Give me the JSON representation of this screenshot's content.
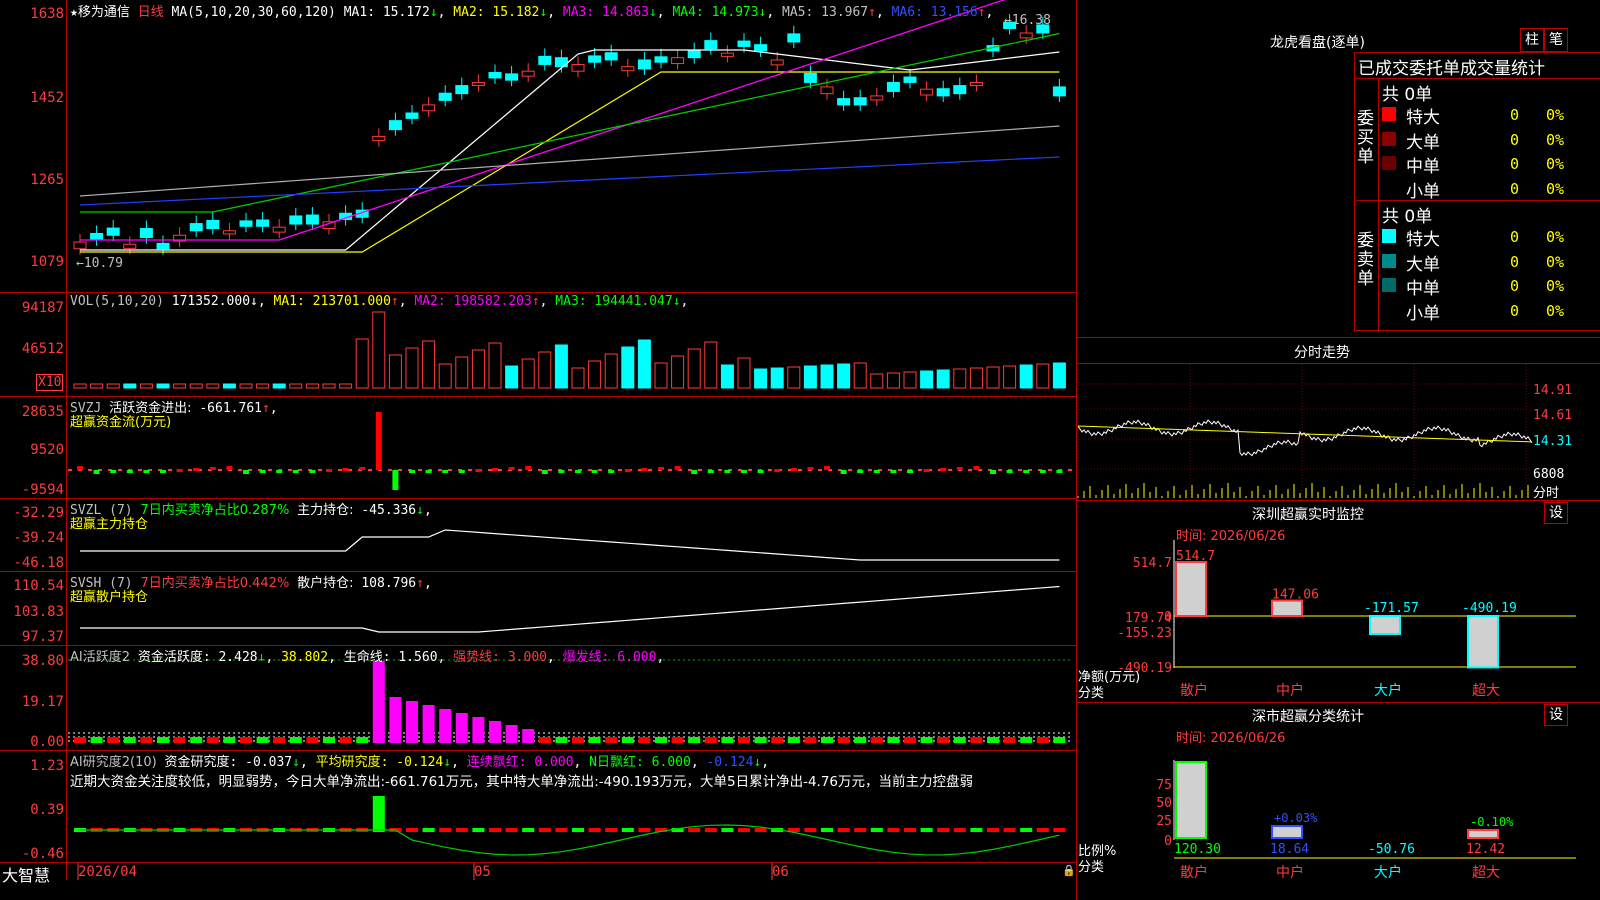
{
  "stock": {
    "star": "★",
    "name": "移为通信",
    "period": "日线",
    "ma_label": "MA(5,10,20,30,60,120)",
    "ma": [
      {
        "name": "MA1",
        "value": "15.172",
        "arrow": "↓",
        "color": "#ffffff"
      },
      {
        "name": "MA2",
        "value": "15.182",
        "arrow": "↓",
        "color": "#ffff00"
      },
      {
        "name": "MA3",
        "value": "14.863",
        "arrow": "↓",
        "color": "#ff00ff"
      },
      {
        "name": "MA4",
        "value": "14.973",
        "arrow": "↓",
        "color": "#00ff00"
      },
      {
        "name": "MA5",
        "value": "13.967",
        "arrow": "↑",
        "color": "#c0c0c0"
      },
      {
        "name": "MA6",
        "value": "13.156",
        "arrow": "↑",
        "color": "#3050ff"
      }
    ],
    "high_label": "16.38",
    "low_label": "10.79",
    "axis": [
      "1638",
      "1452",
      "1265",
      "1079"
    ]
  },
  "vol": {
    "header": "VOL(5,10,20)",
    "value": "171352.000",
    "ma": [
      {
        "name": "MA1",
        "value": "213701.000",
        "arrow": "↑",
        "color": "#ffff00"
      },
      {
        "name": "MA2",
        "value": "198582.203",
        "arrow": "↑",
        "color": "#ff00ff"
      },
      {
        "name": "MA3",
        "value": "194441.047",
        "arrow": "↓",
        "color": "#00ff00"
      }
    ],
    "axis": [
      "94187",
      "46512"
    ],
    "unit": "X10"
  },
  "svzj": {
    "header": "SVZJ",
    "title": "活跃资金进出:",
    "value": "-661.761",
    "arrow": "↑",
    "sub": "超赢资金流(万元)",
    "axis": [
      "28635",
      "9520",
      "-9594"
    ]
  },
  "svzl": {
    "header": "SVZL (7)",
    "desc": "7日内买卖净占比0.287%",
    "title": "主力持仓:",
    "value": "-45.336",
    "arrow": "↓",
    "sub": "超赢主力持仓",
    "axis": [
      "-32.29",
      "-39.24",
      "-46.18"
    ]
  },
  "svsh": {
    "header": "SVSH (7)",
    "desc": "7日内买卖净占比0.442%",
    "title": "散户持仓:",
    "value": "108.796",
    "arrow": "↑",
    "sub": "超赢散户持仓",
    "axis": [
      "110.54",
      "103.83",
      "97.37"
    ]
  },
  "ai_active": {
    "header": "AI活跃度2",
    "items": [
      {
        "label": "资金活跃度:",
        "value": "2.428",
        "arrow": "↓",
        "color": "#ffffff"
      },
      {
        "label": "",
        "value": "38.802",
        "arrow": "",
        "color": "#ffff00"
      },
      {
        "label": "生命线:",
        "value": "1.560",
        "arrow": "",
        "color": "#ffffff"
      },
      {
        "label": "强势线:",
        "value": "3.000",
        "arrow": "",
        "color": "#ff3b3b"
      },
      {
        "label": "爆发线:",
        "value": "6.000",
        "arrow": "",
        "color": "#ff00ff"
      }
    ],
    "axis": [
      "38.80",
      "19.17",
      "0.00"
    ]
  },
  "ai_research": {
    "header": "AI研究度2(10)",
    "items": [
      {
        "label": "资金研究度:",
        "value": "-0.037",
        "arrow": "↓",
        "color": "#ffffff"
      },
      {
        "label": "平均研究度:",
        "value": "-0.124",
        "arrow": "↓",
        "color": "#ffff00"
      },
      {
        "label": "连续飘红:",
        "value": "0.000",
        "arrow": "",
        "color": "#ff00ff"
      },
      {
        "label": "N日飘红:",
        "value": "6.000",
        "arrow": "",
        "color": "#00ff00"
      },
      {
        "label": "",
        "value": "-0.124",
        "arrow": "↓",
        "color": "#3050ff"
      }
    ],
    "comment": "近期大资金关注度较低，明显弱势，今日大单净流出:-661.761万元，其中特大单净流出:-490.193万元，大单5日累计净出-4.76万元，当前主力控盘弱",
    "axis": [
      "1.23",
      "0.39",
      "-0.46"
    ]
  },
  "footer": {
    "brand": "大智慧",
    "dates": [
      "2026/04",
      "05",
      "06"
    ]
  },
  "right": {
    "longhu_title": "龙虎看盘(逐单)",
    "btn_bar": "柱",
    "btn_pen": "笔",
    "tabs_header": "已成交委托单成交量统计",
    "buy_side": "委买单",
    "sell_side": "委卖单",
    "buy_total": "共 0单",
    "sell_total": "共 0单",
    "rows": [
      {
        "name": "特大",
        "count": "0",
        "pct": "0%"
      },
      {
        "name": "大单",
        "count": "0",
        "pct": "0%"
      },
      {
        "name": "中单",
        "count": "0",
        "pct": "0%"
      },
      {
        "name": "小单",
        "count": "0",
        "pct": "0%"
      }
    ],
    "buy_colors": [
      "#ff0000",
      "#8b0000",
      "#6b0000",
      ""
    ],
    "sell_colors": [
      "#00ffff",
      "#008b8b",
      "#006b6b",
      ""
    ],
    "intraday_title": "分时走势",
    "intraday_axis": [
      "14.91",
      "14.61",
      "14.31",
      "6808",
      "分时"
    ],
    "monitor_title": "深圳超赢实时监控",
    "monitor_btn": "设",
    "monitor_time": "时间: 2026/06/26",
    "monitor_axis": [
      "514.7",
      "179.74",
      "0",
      "-155.23",
      "-490.19"
    ],
    "monitor_values": [
      "514.7",
      "147.06",
      "-171.57",
      "-490.19"
    ],
    "monitor_ylabel": "净额(万元)",
    "monitor_xlabel": "分类",
    "categories": [
      "散户",
      "中户",
      "大户",
      "超大"
    ],
    "class_title": "深市超赢分类统计",
    "class_btn": "设",
    "class_time": "时间: 2026/06/26",
    "class_axis": [
      "75",
      "50",
      "25",
      "0"
    ],
    "class_pct": [
      "+0.03%",
      "-0.10%"
    ],
    "class_values": [
      "120.30",
      "18.64",
      "-50.76",
      "12.42"
    ],
    "class_ylabel": "比例%",
    "class_xlabel": "分类"
  }
}
